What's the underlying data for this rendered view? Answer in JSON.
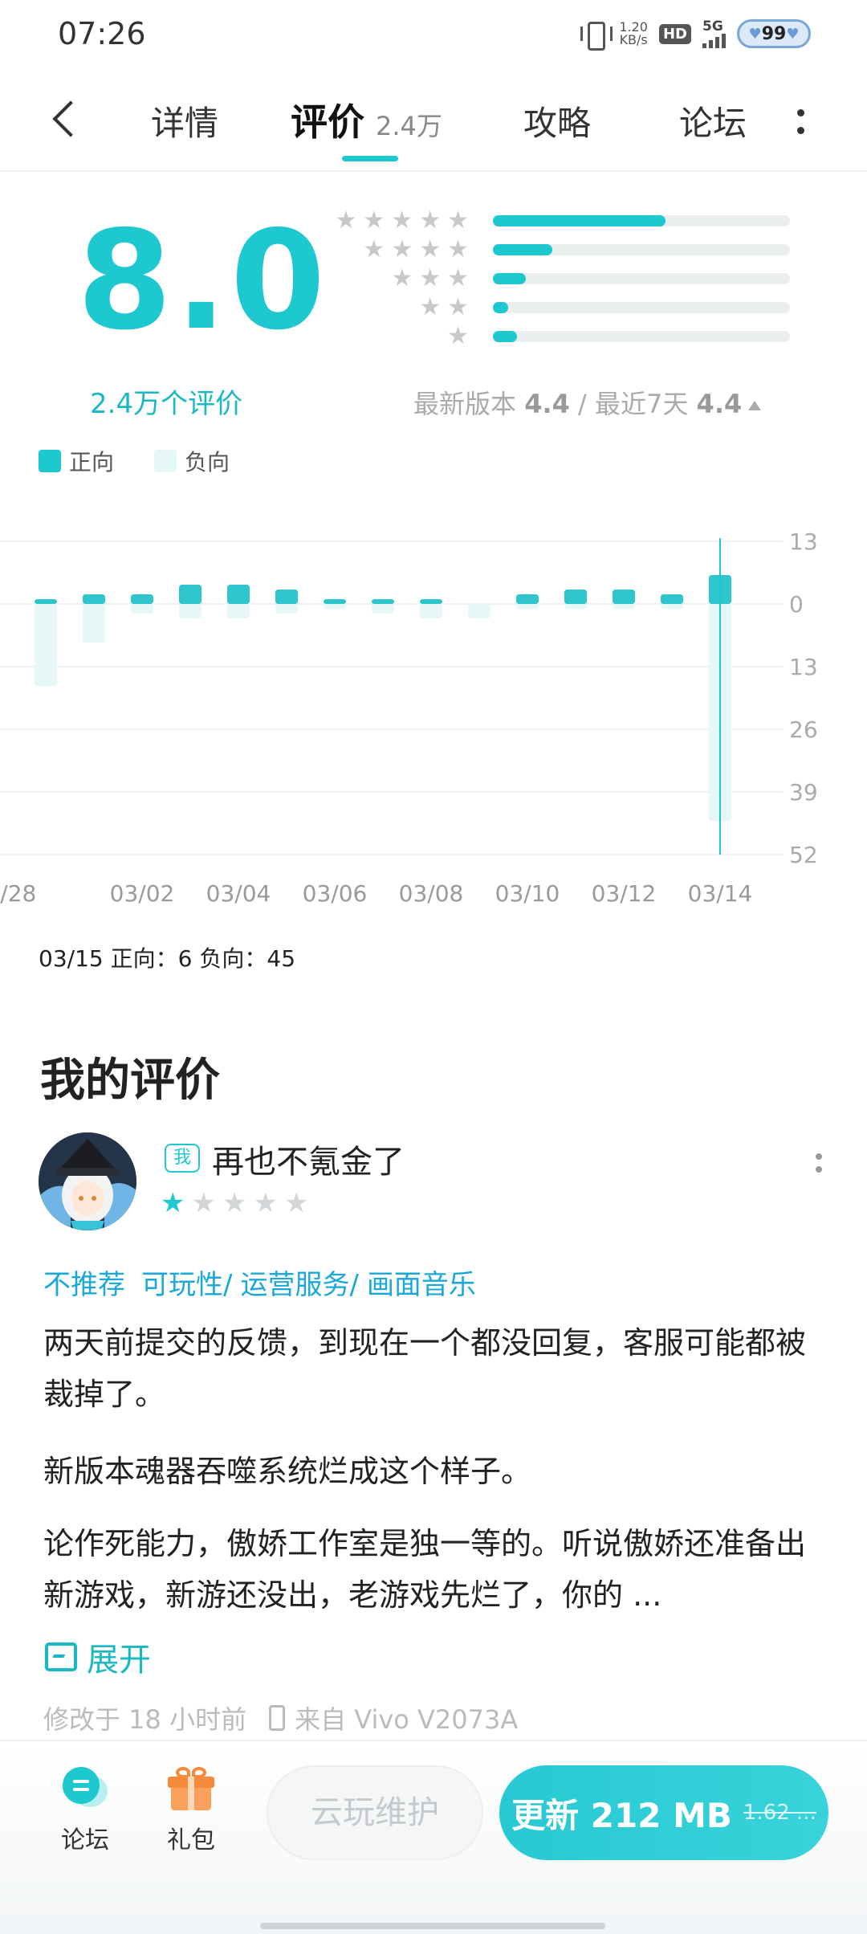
{
  "status_bar": {
    "time": "07:26",
    "net_speed": "1.20",
    "net_unit": "KB/s",
    "hd": "HD",
    "network": "5G",
    "battery": "99"
  },
  "nav": {
    "tabs": [
      {
        "label": "详情"
      },
      {
        "label": "评价",
        "count": "2.4万",
        "active": true
      },
      {
        "label": "攻略"
      },
      {
        "label": "论坛"
      }
    ]
  },
  "rating": {
    "score": "8.0",
    "review_count": "2.4万个评价",
    "distribution": [
      {
        "stars": 5,
        "fraction": 0.58
      },
      {
        "stars": 4,
        "fraction": 0.2
      },
      {
        "stars": 3,
        "fraction": 0.11
      },
      {
        "stars": 2,
        "fraction": 0.05
      },
      {
        "stars": 1,
        "fraction": 0.08
      }
    ],
    "latest_version_label": "最新版本",
    "latest_version_score": "4.4",
    "separator": "/",
    "recent_label": "最近7天",
    "recent_score": "4.4"
  },
  "legend": {
    "positive": "正向",
    "negative": "负向"
  },
  "colors": {
    "accent": "#1ec8cf",
    "negative": "#e6f7f8",
    "positive_bar": "#2ec5cc"
  },
  "chart_data": {
    "type": "bar",
    "categories": [
      "02/28",
      "03/01",
      "03/02",
      "03/03",
      "03/04",
      "03/05",
      "03/06",
      "03/07",
      "03/08",
      "03/09",
      "03/10",
      "03/11",
      "03/12",
      "03/13",
      "03/14",
      "03/15"
    ],
    "x_tick_labels": [
      "02/28",
      "03/02",
      "03/04",
      "03/06",
      "03/08",
      "03/10",
      "03/12",
      "03/14"
    ],
    "series": [
      {
        "name": "正向",
        "values": [
          0.5,
          2,
          2,
          4,
          4,
          3,
          1,
          1,
          1,
          0,
          2,
          3,
          3,
          2,
          6,
          0
        ]
      },
      {
        "name": "负向",
        "values": [
          17,
          8,
          2,
          3,
          3,
          2,
          1,
          2,
          3,
          3,
          1,
          1,
          1,
          1,
          45,
          0
        ]
      }
    ],
    "y_tick_labels": [
      "13",
      "0",
      "13",
      "26",
      "39",
      "52"
    ],
    "ylim": [
      -52,
      13
    ],
    "grid": true,
    "selected": {
      "date": "03/15",
      "positive_label": "正向",
      "positive": "6",
      "negative_label": "负向",
      "negative": "45"
    }
  },
  "my_review": {
    "section_title": "我的评价",
    "me_badge": "我",
    "user_name": "再也不氪金了",
    "stars": 1,
    "tags": [
      "不推荐",
      "可玩性/",
      "运营服务/",
      "画面音乐"
    ],
    "paragraphs": [
      "两天前提交的反馈，到现在一个都没回复，客服可能都被裁掉了。",
      "新版本魂器吞噬系统烂成这个样子。",
      "论作死能力，傲娇工作室是独一等的。听说傲娇还准备出新游戏，新游还没出，老游戏先烂了，你的 ..."
    ],
    "expand_label": "展开",
    "modified": "修改于 18 小时前",
    "device": "来自 Vivo V2073A"
  },
  "bottom_bar": {
    "forum_label": "论坛",
    "gift_label": "礼包",
    "cloud_label": "云玩维护",
    "update_label": "更新 212 MB",
    "old_size": "1.62 ..."
  }
}
